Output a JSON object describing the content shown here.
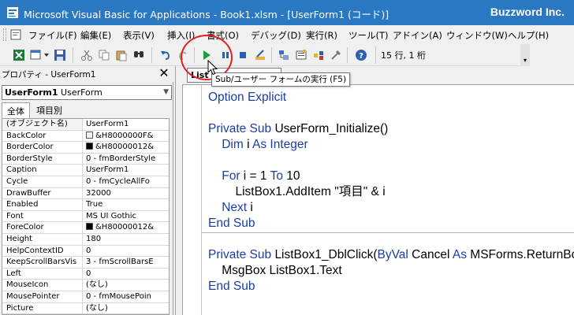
{
  "window": {
    "title": "Microsoft Visual Basic for Applications - Book1.xlsm - [UserForm1 (コード)]",
    "brand": "Buzzword Inc."
  },
  "menu": {
    "items": [
      {
        "label": "ファイル(F)"
      },
      {
        "label": "編集(E)"
      },
      {
        "label": "表示(V)"
      },
      {
        "label": "挿入(I)"
      },
      {
        "label": "書式(O)"
      },
      {
        "label": "デバッグ(D)"
      },
      {
        "label": "実行(R)"
      },
      {
        "label": "ツール(T)"
      },
      {
        "label": "アドイン(A)"
      },
      {
        "label": "ウィンドウ(W)"
      },
      {
        "label": "ヘルプ(H)"
      }
    ]
  },
  "toolbar": {
    "status": "15 行, 1 桁",
    "icons": [
      "excel-icon",
      "insert-icon",
      "save-icon",
      "cut-icon",
      "copy-icon",
      "paste-icon",
      "find-icon",
      "undo-icon",
      "redo-icon",
      "run-icon",
      "break-icon",
      "reset-icon",
      "design-mode-icon",
      "project-explorer-icon",
      "properties-icon",
      "object-browser-icon",
      "toolbox-icon",
      "help-icon"
    ]
  },
  "tooltip": {
    "text": "Sub/ユーザー フォームの実行 (F5)"
  },
  "properties": {
    "title": "プロパティ - UserForm1",
    "combo_name": "UserForm1",
    "combo_type": "UserForm",
    "tabs": [
      {
        "label": "全体"
      },
      {
        "label": "項目別"
      }
    ],
    "rows": [
      {
        "name": "(オブジェクト名)",
        "value": "UserForm1"
      },
      {
        "name": "BackColor",
        "value": "&H8000000F&",
        "swatch": "#f0f0f0"
      },
      {
        "name": "BorderColor",
        "value": "&H80000012&",
        "swatch": "#000000"
      },
      {
        "name": "BorderStyle",
        "value": "0 - fmBorderStyle"
      },
      {
        "name": "Caption",
        "value": "UserForm1"
      },
      {
        "name": "Cycle",
        "value": "0 - fmCycleAllFo"
      },
      {
        "name": "DrawBuffer",
        "value": "32000"
      },
      {
        "name": "Enabled",
        "value": "True"
      },
      {
        "name": "Font",
        "value": "MS UI Gothic"
      },
      {
        "name": "ForeColor",
        "value": "&H80000012&",
        "swatch": "#000000"
      },
      {
        "name": "Height",
        "value": "180"
      },
      {
        "name": "HelpContextID",
        "value": "0"
      },
      {
        "name": "KeepScrollBarsVis",
        "value": "3 - fmScrollBarsE"
      },
      {
        "name": "Left",
        "value": "0"
      },
      {
        "name": "MouseIcon",
        "value": "(なし)"
      },
      {
        "name": "MousePointer",
        "value": "0 - fmMousePoin"
      },
      {
        "name": "Picture",
        "value": "(なし)"
      }
    ]
  },
  "code": {
    "object_combo": "List",
    "lines": [
      [
        {
          "t": "Option Explicit",
          "k": true
        }
      ],
      [],
      [
        {
          "t": "Private Sub ",
          "k": true
        },
        {
          "t": "UserForm_Initialize()"
        }
      ],
      [
        {
          "t": "    "
        },
        {
          "t": "Dim ",
          "k": true
        },
        {
          "t": "i "
        },
        {
          "t": "As Integer",
          "k": true
        }
      ],
      [],
      [
        {
          "t": "    "
        },
        {
          "t": "For ",
          "k": true
        },
        {
          "t": "i = 1 "
        },
        {
          "t": "To ",
          "k": true
        },
        {
          "t": "10"
        }
      ],
      [
        {
          "t": "        ListBox1.AddItem \"項目\" & i"
        }
      ],
      [
        {
          "t": "    "
        },
        {
          "t": "Next ",
          "k": true
        },
        {
          "t": "i"
        }
      ],
      [
        {
          "t": "End Sub",
          "k": true
        }
      ],
      [],
      [
        {
          "t": "Private Sub ",
          "k": true
        },
        {
          "t": "ListBox1_DblClick("
        },
        {
          "t": "ByVal ",
          "k": true
        },
        {
          "t": "Cancel "
        },
        {
          "t": "As ",
          "k": true
        },
        {
          "t": "MSForms.ReturnBoolean)"
        }
      ],
      [
        {
          "t": "    MsgBox ListBox1.Text"
        }
      ],
      [
        {
          "t": "End Sub",
          "k": true
        }
      ]
    ]
  },
  "colors": {
    "titlebar": "#2b78c2",
    "keyword": "#1a3da6",
    "highlight": "#e02020"
  }
}
